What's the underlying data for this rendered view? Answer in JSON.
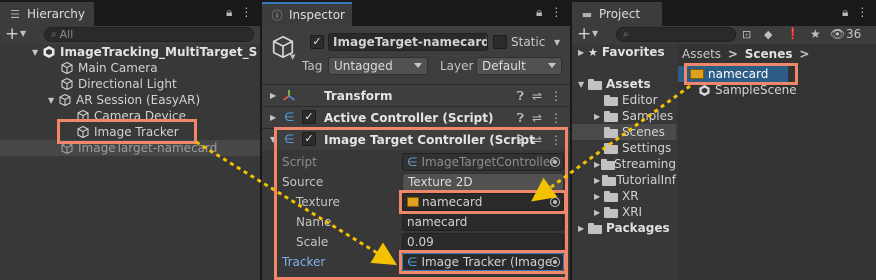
{
  "hierarchy": {
    "tab_label": "Hierarchy",
    "add_label": "+",
    "search_placeholder": "All",
    "items": [
      {
        "label": "ImageTracking_MultiTarget_S"
      },
      {
        "label": "Main Camera"
      },
      {
        "label": "Directional Light"
      },
      {
        "label": "AR Session (EasyAR)"
      },
      {
        "label": "Camera Device"
      },
      {
        "label": "Image Tracker"
      },
      {
        "label": "ImageTarget-namecard"
      }
    ]
  },
  "inspector": {
    "tab_label": "Inspector",
    "object_name": "ImageTarget-namecard",
    "static_label": "Static",
    "tag_label": "Tag",
    "tag_value": "Untagged",
    "layer_label": "Layer",
    "layer_value": "Default",
    "components": [
      {
        "label": "Transform"
      },
      {
        "label": "Active Controller (Script)"
      },
      {
        "label": "Image Target Controller (Script"
      }
    ],
    "fields": {
      "script_label": "Script",
      "script_value": "ImageTargetController",
      "source_label": "Source",
      "source_value": "Texture 2D",
      "texture_label": "Texture",
      "texture_value": "namecard",
      "name_label": "Name",
      "name_value": "namecard",
      "scale_label": "Scale",
      "scale_value": "0.09",
      "tracker_label": "Tracker",
      "tracker_value": "Image Tracker (Image"
    }
  },
  "project": {
    "tab_label": "Project",
    "add_label": "+",
    "hidden_count": "36",
    "favorites_label": "Favorites",
    "assets_label": "Assets",
    "folders": [
      "Editor",
      "Samples",
      "Scenes",
      "Settings",
      "Streaming",
      "TutorialInf",
      "XR",
      "XRI"
    ],
    "packages_label": "Packages",
    "breadcrumb": {
      "root": "Assets",
      "current": "Scenes"
    },
    "files": [
      {
        "label": "namecard"
      },
      {
        "label": "SampleScene"
      }
    ]
  },
  "colors": {
    "highlight": "#f0866a",
    "arrow": "#f2c200",
    "selection": "#2c5d87",
    "tracker_label": "#7fb0f0"
  }
}
